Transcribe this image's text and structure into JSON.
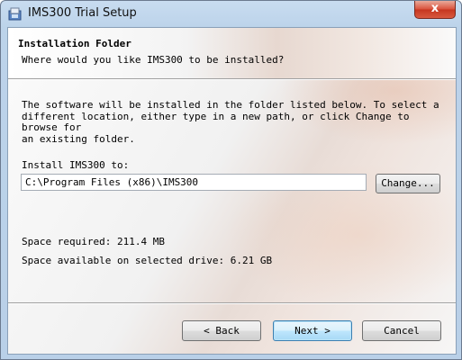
{
  "window": {
    "title": "IMS300 Trial Setup",
    "close_symbol": "x"
  },
  "header": {
    "title": "Installation Folder",
    "subtitle": "Where would you like IMS300 to be installed?"
  },
  "body": {
    "description": "The software will be installed in the folder listed below. To select a\ndifferent location, either type in a new path, or click Change to browse for\nan existing folder.",
    "install_label": "Install IMS300 to:",
    "install_path": "C:\\Program Files (x86)\\IMS300",
    "change_label": "Change...",
    "space_required": "Space required: 211.4 MB",
    "space_available": "Space available on selected drive: 6.21 GB"
  },
  "buttons": {
    "back": "< Back",
    "next": "Next >",
    "cancel": "Cancel"
  },
  "icons": {
    "app": "installer-icon",
    "close": "close-icon"
  },
  "colors": {
    "next_border": "#3c7fb1",
    "close_red": "#c5351f"
  }
}
